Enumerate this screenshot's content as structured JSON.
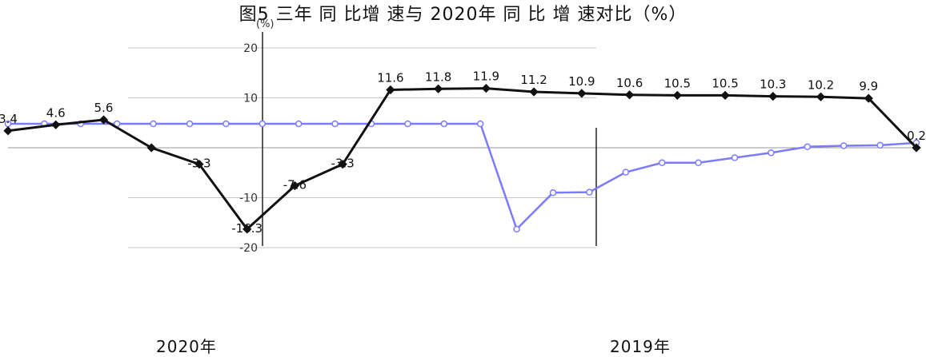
{
  "title": "图5 三年 同 比增 速与 2020年 同 比 增 速对比（%）",
  "chart_data": {
    "type": "line",
    "title": "图5 三年 同 比增 速与 2020年 同 比 增 速对比（%）",
    "ylabel": "(%)",
    "ylim": [
      -20,
      20
    ],
    "yticks": [
      -20,
      -10,
      10,
      20
    ],
    "year_labels": [
      "2020年",
      "2019年"
    ],
    "series": [
      {
        "name": "2020年",
        "color": "#7b7bff",
        "values": [
          4.8,
          4.8,
          4.8,
          4.8,
          4.8,
          4.8,
          4.8,
          4.8,
          4.8,
          4.8,
          4.8,
          4.8,
          4.8,
          4.8,
          -16.3,
          -9,
          -8.9,
          -4.9,
          -3,
          -3,
          -2,
          -1,
          0.2,
          0.4,
          0.5,
          1
        ],
        "labels": []
      },
      {
        "name": "2019年",
        "color": "#111111",
        "values": [
          3.4,
          4.6,
          5.6,
          0,
          -3.3,
          -16.3,
          -7.6,
          -3.3,
          11.6,
          11.8,
          11.9,
          11.2,
          10.9,
          10.6,
          10.5,
          10.5,
          10.3,
          10.2,
          9.9,
          0
        ],
        "labels": [
          "3.4",
          "4.6",
          "5.6",
          "",
          "-3.3",
          "-16.3",
          "-7.6",
          "-3.3",
          "11.6",
          "11.8",
          "11.9",
          "11.2",
          "10.9",
          "10.6",
          "10.5",
          "10.5",
          "10.3",
          "10.2",
          "9.9",
          "0.2"
        ]
      }
    ]
  }
}
